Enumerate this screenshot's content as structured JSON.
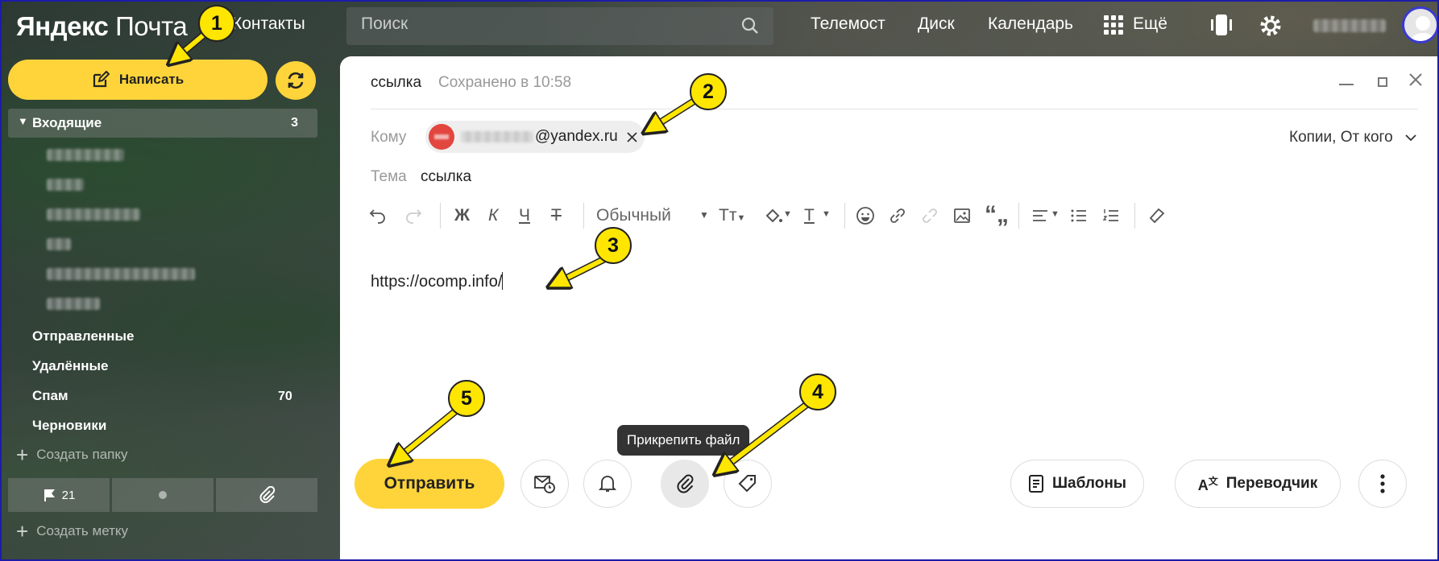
{
  "header": {
    "logo_brand": "Яндекс",
    "logo_product": "Почта",
    "contacts": "Контакты",
    "search_placeholder": "Поиск",
    "nav": [
      "Телемост",
      "Диск",
      "Календарь",
      "Ещё"
    ]
  },
  "sidebar": {
    "compose_label": "Написать",
    "inbox": {
      "label": "Входящие",
      "count": "3"
    },
    "folders": [
      {
        "label": "Отправленные",
        "count": ""
      },
      {
        "label": "Удалённые",
        "count": ""
      },
      {
        "label": "Спам",
        "count": "70"
      },
      {
        "label": "Черновики",
        "count": ""
      }
    ],
    "create_folder": "Создать папку",
    "flagged_count": "21",
    "create_label": "Создать метку"
  },
  "compose": {
    "subject_title": "ссылка",
    "saved_status": "Сохранено в 10:58",
    "to_label": "Кому",
    "recipient_domain": "@yandex.ru",
    "cc_label": "Копии, От кого",
    "subject_label": "Тема",
    "subject_value": "ссылка",
    "toolbar": {
      "bold": "Ж",
      "italic": "К",
      "underline": "Ч",
      "strike": "Т",
      "style": "Обычный"
    },
    "body_text": "https://ocomp.info/",
    "send_label": "Отправить",
    "attach_tooltip": "Прикрепить файл",
    "templates_label": "Шаблоны",
    "translator_label": "Переводчик"
  },
  "annotations": [
    "1",
    "2",
    "3",
    "4",
    "5"
  ],
  "colors": {
    "accent": "#ffd43a",
    "marker": "#ffe600",
    "frame": "#1c1ca8"
  }
}
